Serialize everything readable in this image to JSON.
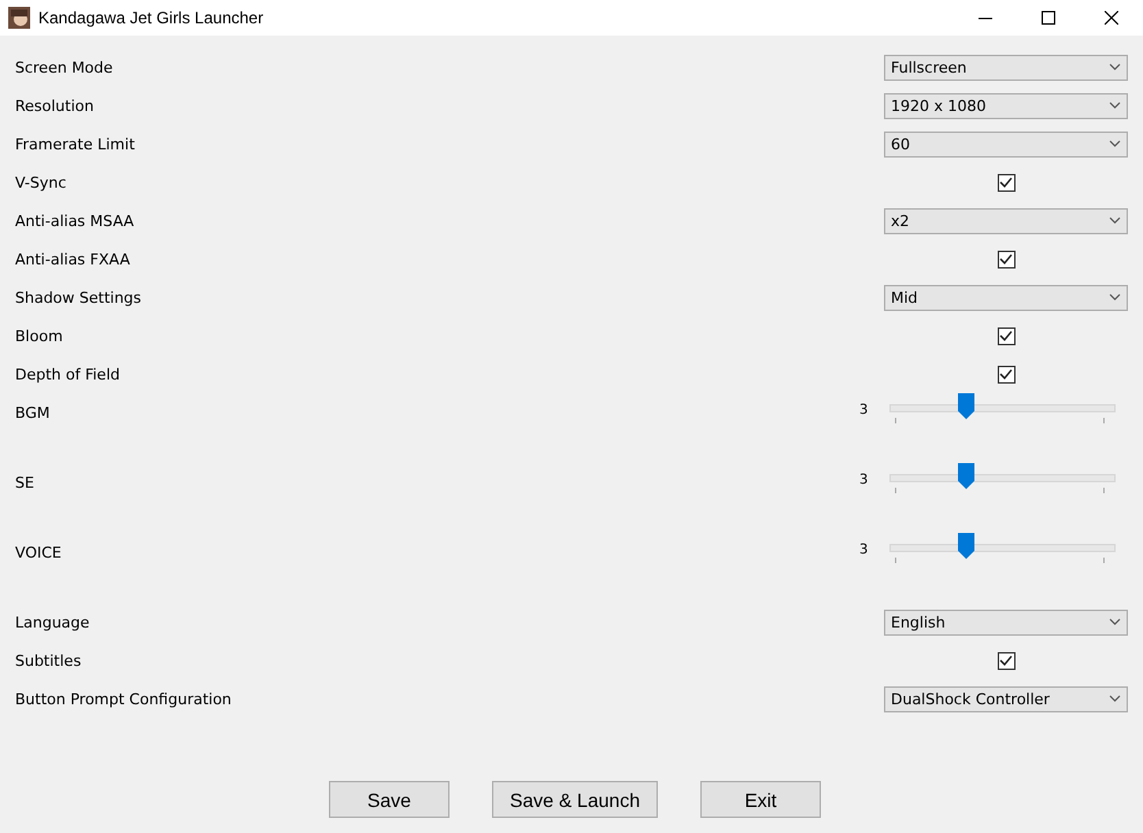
{
  "window": {
    "title": "Kandagawa Jet Girls Launcher"
  },
  "settings": [
    {
      "kind": "select",
      "label": "Screen Mode",
      "value": "Fullscreen"
    },
    {
      "kind": "select",
      "label": "Resolution",
      "value": "1920 x 1080"
    },
    {
      "kind": "select",
      "label": "Framerate Limit",
      "value": "60"
    },
    {
      "kind": "checkbox",
      "label": "V-Sync",
      "checked": true
    },
    {
      "kind": "select",
      "label": "Anti-alias MSAA",
      "value": "x2"
    },
    {
      "kind": "checkbox",
      "label": "Anti-alias FXAA",
      "checked": true
    },
    {
      "kind": "select",
      "label": "Shadow Settings",
      "value": "Mid"
    },
    {
      "kind": "checkbox",
      "label": "Bloom",
      "checked": true
    },
    {
      "kind": "checkbox",
      "label": "Depth of Field",
      "checked": true
    },
    {
      "kind": "slider",
      "label": "BGM",
      "reading": "3",
      "level": 0.34
    },
    {
      "kind": "slider",
      "label": "SE",
      "reading": "3",
      "level": 0.34
    },
    {
      "kind": "slider",
      "label": "VOICE",
      "reading": "3",
      "level": 0.34
    },
    {
      "kind": "select",
      "label": "Language",
      "value": "English"
    },
    {
      "kind": "checkbox",
      "label": "Subtitles",
      "checked": true
    },
    {
      "kind": "select",
      "label": "Button Prompt Configuration",
      "value": "DualShock Controller"
    }
  ],
  "buttons": [
    "Save",
    "Save & Launch",
    "Exit"
  ]
}
